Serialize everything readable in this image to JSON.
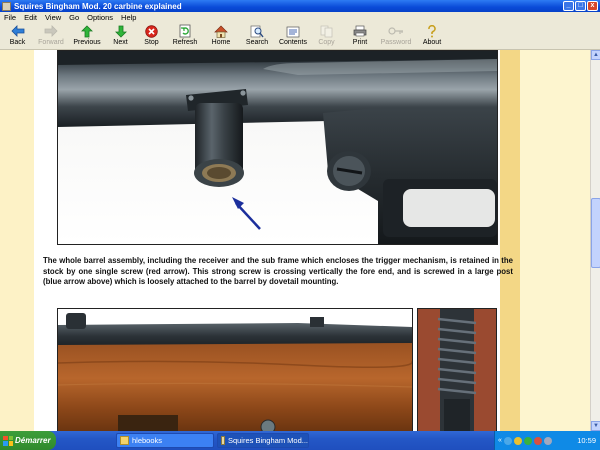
{
  "window": {
    "title": "Squires Bingham Mod. 20 carbine explained",
    "buttons": {
      "minimize": "_",
      "maximize": "□",
      "close": "x"
    }
  },
  "menu": [
    "File",
    "Edit",
    "View",
    "Go",
    "Options",
    "Help"
  ],
  "toolbar": [
    {
      "label": "Back",
      "icon": "back-arrow-icon",
      "enabled": true
    },
    {
      "label": "Forward",
      "icon": "forward-arrow-icon",
      "enabled": false
    },
    {
      "label": "Previous",
      "icon": "up-arrow-icon",
      "enabled": true
    },
    {
      "label": "Next",
      "icon": "down-arrow-icon",
      "enabled": true
    },
    {
      "label": "Stop",
      "icon": "stop-icon",
      "enabled": true
    },
    {
      "label": "Refresh",
      "icon": "refresh-icon",
      "enabled": true
    },
    {
      "label": "Home",
      "icon": "home-icon",
      "enabled": true
    },
    {
      "label": "Search",
      "icon": "search-icon",
      "enabled": true
    },
    {
      "label": "Contents",
      "icon": "contents-icon",
      "enabled": true
    },
    {
      "label": "Copy",
      "icon": "copy-icon",
      "enabled": false
    },
    {
      "label": "Print",
      "icon": "print-icon",
      "enabled": true
    },
    {
      "label": "Password",
      "icon": "key-icon",
      "enabled": false
    },
    {
      "label": "About",
      "icon": "about-icon",
      "enabled": true
    }
  ],
  "content": {
    "caption": "The whole barrel assembly, including the receiver and the sub frame which encloses the trigger mechanism, is retained in the stock by one single screw (red arrow). This strong screw is crossing vertically the fore end, and is screwed in a large post (blue arrow above) which is loosely attached to the barrel by dovetail mounting."
  },
  "taskbar": {
    "start_label": "Démarrer",
    "tasks": [
      {
        "label": "hlebooks",
        "active": false
      },
      {
        "label": "Squires Bingham Mod...",
        "active": true
      }
    ],
    "clock": "10:59"
  },
  "colors": {
    "title_bar": "#0a4ad8",
    "page_margin_left": "#fdf2c6",
    "page_stripe_right": "#f3d786",
    "taskbar": "#2457c6",
    "start_button": "#3c9e3a"
  }
}
